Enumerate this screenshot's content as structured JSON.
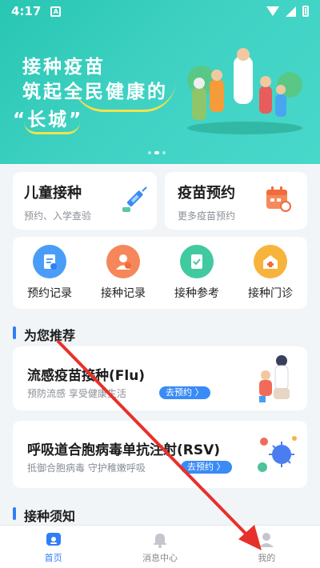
{
  "status": {
    "time": "4:17",
    "notif_letter": "A"
  },
  "banner": {
    "line1": "接种疫苗",
    "line2": "筑起全民健康的",
    "line3": "“长城”",
    "dots": 3,
    "active_dot": 1
  },
  "cards": {
    "child": {
      "title": "儿童接种",
      "sub": "预约、入学查验",
      "icon": "syringe-icon"
    },
    "vaccine": {
      "title": "疫苗预约",
      "sub": "更多疫苗预约",
      "icon": "calendar-icon"
    }
  },
  "quick": [
    {
      "label": "预约记录",
      "icon": "appointment-record-icon",
      "color": "#4a9df7"
    },
    {
      "label": "接种记录",
      "icon": "vaccination-record-icon",
      "color": "#f5875a"
    },
    {
      "label": "接种参考",
      "icon": "reference-icon",
      "color": "#41c9a0"
    },
    {
      "label": "接种门诊",
      "icon": "clinic-icon",
      "color": "#f7b43d"
    }
  ],
  "recommend": {
    "section_title": "为您推荐",
    "items": [
      {
        "title": "流感疫苗接种(Flu)",
        "sub": "预防流感 享受健康生活",
        "button": "去预约 〉",
        "icon": "doctor-vaccination-illustration"
      },
      {
        "title": "呼吸道合胞病毒单抗注射(RSV)",
        "sub": "抵御合胞病毒 守护稚嫩呼吸",
        "button": "去预约 〉",
        "icon": "virus-illustration"
      }
    ]
  },
  "notice": {
    "section_title": "接种须知"
  },
  "tabs": [
    {
      "label": "首页",
      "icon": "home-icon",
      "active": true
    },
    {
      "label": "消息中心",
      "icon": "bell-icon",
      "active": false
    },
    {
      "label": "我的",
      "icon": "profile-icon",
      "active": false
    }
  ],
  "colors": {
    "primary": "#2f7ef5",
    "banner": "#3ed1c2",
    "arrow": "#e8302a"
  }
}
